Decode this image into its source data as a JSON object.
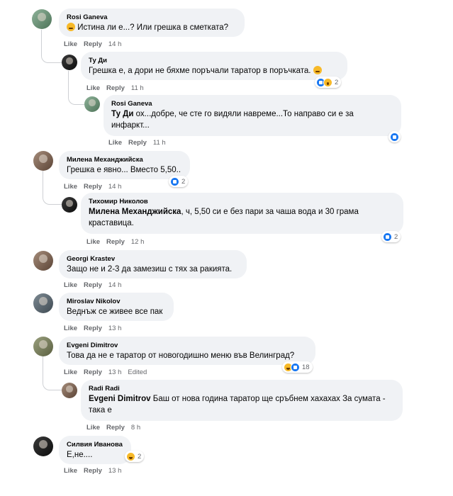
{
  "comments": [
    {
      "name": "Rosi Ganeva",
      "text": "Истина ли е...? Или грешка в сметката?",
      "actions": {
        "like": "Like",
        "reply": "Reply",
        "time": "14 h"
      }
    },
    {
      "name": "Ту Ди",
      "text": "Грешка е, а дори не бяхме поръчали таратор в поръчката.",
      "actions": {
        "like": "Like",
        "reply": "Reply",
        "time": "11 h"
      },
      "reactions": "2"
    },
    {
      "name": "Rosi Ganeva",
      "mention": "Ту Ди",
      "text": "ох...добре, че сте го видяли навреме...То направо си е за инфаркт...",
      "actions": {
        "like": "Like",
        "reply": "Reply",
        "time": "11 h"
      }
    },
    {
      "name": "Милена Механджийска",
      "text": "Грешка е явно... Вместо 5,50..",
      "actions": {
        "like": "Like",
        "reply": "Reply",
        "time": "14 h"
      },
      "reactions": "2"
    },
    {
      "name": "Тихомир Николов",
      "mention": "Милена Механджийска",
      "text": ", ч, 5,50 си е без пари за чаша вода и 30 грама краставица.",
      "actions": {
        "like": "Like",
        "reply": "Reply",
        "time": "12 h"
      },
      "reactions": "2"
    },
    {
      "name": "Georgi Krastev",
      "text": "Защо не и 2-3 да замезиш с тях за ракията.",
      "actions": {
        "like": "Like",
        "reply": "Reply",
        "time": "14 h"
      }
    },
    {
      "name": "Miroslav Nikolov",
      "text": "Веднъж се живее все пак",
      "actions": {
        "like": "Like",
        "reply": "Reply",
        "time": "13 h"
      }
    },
    {
      "name": "Evgeni Dimitrov",
      "text": "Това да не е таратор от новогодишно меню във Велинград?",
      "actions": {
        "like": "Like",
        "reply": "Reply",
        "time": "13 h",
        "edited": "Edited"
      },
      "reactions": "18"
    },
    {
      "name": "Radi Radi",
      "mention": "Evgeni Dimitrov",
      "text": "Баш от нова година таратор ще сръбнем хахахах За сумата - така е",
      "actions": {
        "like": "Like",
        "reply": "Reply",
        "time": "8 h"
      }
    },
    {
      "name": "Силвия Иванова",
      "text": "Е,не....",
      "actions": {
        "like": "Like",
        "reply": "Reply",
        "time": "13 h"
      },
      "reactions": "2"
    }
  ],
  "icons": {
    "like": "like-reaction-icon",
    "haha": "haha-reaction-icon",
    "wow": "wow-reaction-icon",
    "emoji": "emoji-icon"
  },
  "colors": {
    "bubble": "#f0f2f5",
    "like": "#1877f2",
    "meta": "#65676b"
  }
}
